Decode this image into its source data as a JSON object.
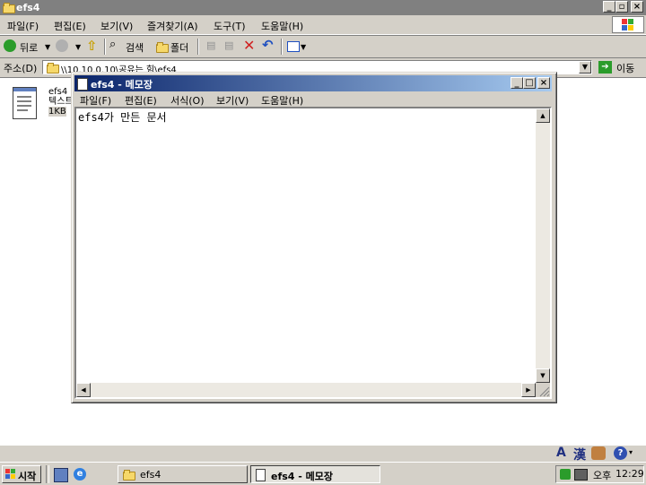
{
  "explorer": {
    "title": "efs4",
    "menu": [
      "파일(F)",
      "편집(E)",
      "보기(V)",
      "즐겨찾기(A)",
      "도구(T)",
      "도움말(H)"
    ],
    "toolbar": {
      "back": "뒤로",
      "search": "검색",
      "folders": "폴더"
    },
    "address_label": "주소(D)",
    "address_value": "\\\\10.10.0.10\\공유는 힘\\efs4",
    "go_label": "이동",
    "file": {
      "name": "efs4",
      "type": "텍스트",
      "size": "1KB"
    }
  },
  "notepad": {
    "title": "efs4 - 메모장",
    "menu": [
      "파일(F)",
      "편집(E)",
      "서식(O)",
      "보기(V)",
      "도움말(H)"
    ],
    "content": "efs4가 만든 문서"
  },
  "taskbar": {
    "start": "시작",
    "tasks": [
      "efs4",
      "efs4 - 메모장"
    ],
    "ampm": "오후",
    "time": "12:29"
  },
  "ime": {
    "mode": "A",
    "hanja": "漢"
  },
  "colors": {
    "title_active": "#0a246a",
    "title_inactive": "#808080",
    "face": "#d4d0c8"
  }
}
